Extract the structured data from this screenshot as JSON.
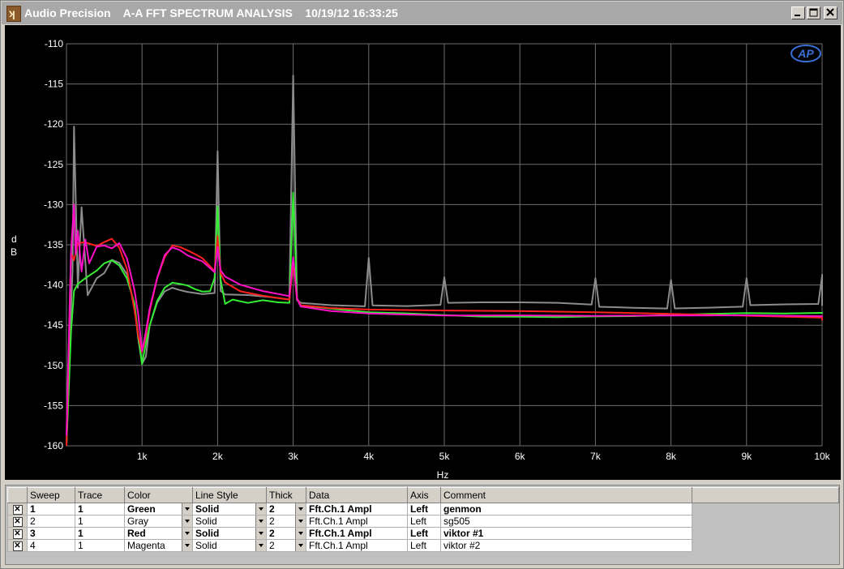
{
  "window": {
    "title": "Audio Precision    A-A FFT SPECTRUM ANALYSIS    10/19/12 16:33:25",
    "app_icon": "audio-precision-logo-icon",
    "controls": [
      "minimize-icon",
      "maximize-icon",
      "close-icon"
    ]
  },
  "graph": {
    "logo_text": "AP",
    "x_axis_label": "Hz",
    "y_axis_label_lines": [
      "d",
      "B"
    ],
    "y_ticks": [
      "-110",
      "-115",
      "-120",
      "-125",
      "-130",
      "-135",
      "-140",
      "-145",
      "-150",
      "-155",
      "-160"
    ],
    "x_ticks": [
      "1k",
      "2k",
      "3k",
      "4k",
      "5k",
      "6k",
      "7k",
      "8k",
      "9k",
      "10k"
    ],
    "grid_color": "#6e6e6e",
    "background": "#000000"
  },
  "chart_data": {
    "type": "line",
    "xlabel": "Hz",
    "ylabel": "dB",
    "xlim": [
      0,
      10000
    ],
    "ylim": [
      -160,
      -110
    ],
    "grid": true,
    "series": [
      {
        "name": "genmon",
        "color": "#33ee33",
        "x": [
          0,
          60,
          100,
          150,
          250,
          400,
          500,
          600,
          700,
          800,
          900,
          950,
          1000,
          1050,
          1100,
          1200,
          1300,
          1400,
          1500,
          1600,
          1700,
          1800,
          1900,
          1960,
          2000,
          2040,
          2100,
          2200,
          2400,
          2600,
          2800,
          2950,
          3000,
          3050,
          3100,
          3300,
          3600,
          4000,
          4500,
          5000,
          5500,
          6000,
          6500,
          7000,
          7500,
          8000,
          8500,
          9000,
          9500,
          10000,
          10100
        ],
        "y": [
          -160,
          -146,
          -141,
          -140.2,
          -139.5,
          -138.5,
          -137.5,
          -137,
          -137.5,
          -139,
          -142,
          -146,
          -149.5,
          -147,
          -145,
          -142,
          -140.5,
          -140,
          -140.2,
          -140.4,
          -140.8,
          -141,
          -140.8,
          -139,
          -130,
          -139,
          -142,
          -141.5,
          -142,
          -141.8,
          -142.2,
          -142.4,
          -128.8,
          -142,
          -143,
          -143,
          -143.2,
          -143.4,
          -143.4,
          -143.5,
          -143.6,
          -143.6,
          -143.7,
          -143.7,
          -143.8,
          -143.8,
          -143.8,
          -143.8,
          -143.9,
          -143.8,
          -143.8
        ]
      },
      {
        "name": "sg505",
        "color": "#8c8c8c",
        "x": [
          0,
          60,
          80,
          100,
          150,
          200,
          280,
          400,
          500,
          600,
          700,
          800,
          900,
          950,
          1000,
          1050,
          1100,
          1200,
          1300,
          1400,
          1500,
          1600,
          1800,
          1960,
          2000,
          2040,
          2100,
          2400,
          2700,
          2950,
          3000,
          3050,
          3100,
          3500,
          3950,
          4000,
          4050,
          4500,
          4950,
          5000,
          5050,
          5500,
          6000,
          6500,
          6950,
          7000,
          7050,
          7500,
          7950,
          8000,
          8050,
          8500,
          8950,
          9000,
          9050,
          9500,
          9950,
          10000,
          10050,
          10100
        ],
        "y": [
          -160,
          -143,
          -138,
          -120,
          -140,
          -130,
          -141,
          -139,
          -138.5,
          -137,
          -137.5,
          -139,
          -143,
          -147,
          -150,
          -149,
          -145,
          -142,
          -140.5,
          -140,
          -140.3,
          -140.6,
          -141,
          -141,
          -123.5,
          -141,
          -141.5,
          -141.6,
          -141.8,
          -142,
          -114,
          -141.8,
          -142,
          -142.2,
          -142.3,
          -136.3,
          -142.3,
          -142.5,
          -142.5,
          -139.2,
          -142.5,
          -142.5,
          -142.5,
          -142.5,
          -142.6,
          -139.2,
          -142.6,
          -142.6,
          -142.6,
          -139,
          -142.6,
          -142.6,
          -142.6,
          -139.2,
          -142.7,
          -142.7,
          -142.7,
          -139.2,
          -142.8,
          -138.8
        ]
      },
      {
        "name": "viktor #1",
        "color": "#ff2020",
        "x": [
          0,
          60,
          100,
          150,
          250,
          400,
          500,
          600,
          700,
          800,
          900,
          950,
          1000,
          1050,
          1100,
          1200,
          1300,
          1400,
          1500,
          1600,
          1700,
          1800,
          1960,
          2000,
          2040,
          2100,
          2300,
          2600,
          2950,
          3000,
          3050,
          3100,
          3500,
          4000,
          5000,
          6000,
          7000,
          8000,
          9000,
          10000,
          10100
        ],
        "y": [
          -160,
          -136,
          -137,
          -135,
          -135,
          -135.5,
          -135,
          -134.5,
          -135.5,
          -138,
          -143,
          -146,
          -148,
          -146,
          -143,
          -139,
          -136.5,
          -135.2,
          -135.5,
          -136,
          -136.5,
          -137,
          -138.5,
          -134,
          -138.5,
          -139.5,
          -140.5,
          -141,
          -141.5,
          -137,
          -141.5,
          -142.5,
          -143,
          -143.3,
          -143.5,
          -143.6,
          -143.7,
          -143.8,
          -143.9,
          -144,
          -144.2
        ]
      },
      {
        "name": "viktor #2",
        "color": "#ff10c8",
        "x": [
          0,
          60,
          100,
          120,
          150,
          200,
          250,
          300,
          400,
          500,
          600,
          700,
          800,
          900,
          950,
          1000,
          1050,
          1100,
          1200,
          1300,
          1400,
          1500,
          1600,
          1700,
          1800,
          1960,
          2000,
          2040,
          2100,
          2300,
          2600,
          2950,
          3000,
          3050,
          3100,
          3500,
          4000,
          5000,
          6000,
          7000,
          8000,
          9000,
          10000,
          10100
        ],
        "y": [
          -159,
          -136,
          -130,
          -136,
          -133,
          -138,
          -134,
          -137,
          -135,
          -135,
          -135.5,
          -135,
          -137,
          -141,
          -144,
          -148.5,
          -146,
          -143,
          -139,
          -136,
          -135,
          -135.3,
          -136,
          -136.5,
          -137,
          -138.5,
          -135.5,
          -138.5,
          -139.3,
          -140.3,
          -141,
          -141.5,
          -136.5,
          -141.5,
          -142.4,
          -142.9,
          -143.2,
          -143.5,
          -143.6,
          -143.8,
          -143.9,
          -144,
          -144.2,
          -144.3
        ]
      }
    ]
  },
  "table": {
    "headers": [
      "",
      "Sweep",
      "Trace",
      "Color",
      "Line Style",
      "Thick",
      "Data",
      "Axis",
      "Comment"
    ],
    "rows": [
      {
        "checked": "✕",
        "sweep": "1",
        "trace": "1",
        "color": "Green",
        "style": "Solid",
        "thick": "2",
        "data": "Fft.Ch.1 Ampl",
        "axis": "Left",
        "comment": "genmon",
        "bold": true
      },
      {
        "checked": "✕",
        "sweep": "2",
        "trace": "1",
        "color": "Gray",
        "style": "Solid",
        "thick": "2",
        "data": "Fft.Ch.1 Ampl",
        "axis": "Left",
        "comment": "sg505",
        "bold": false
      },
      {
        "checked": "✕",
        "sweep": "3",
        "trace": "1",
        "color": "Red",
        "style": "Solid",
        "thick": "2",
        "data": "Fft.Ch.1 Ampl",
        "axis": "Left",
        "comment": "viktor #1",
        "bold": true
      },
      {
        "checked": "✕",
        "sweep": "4",
        "trace": "1",
        "color": "Magenta",
        "style": "Solid",
        "thick": "2",
        "data": "Fft.Ch.1 Ampl",
        "axis": "Left",
        "comment": "viktor #2",
        "bold": false
      }
    ]
  }
}
